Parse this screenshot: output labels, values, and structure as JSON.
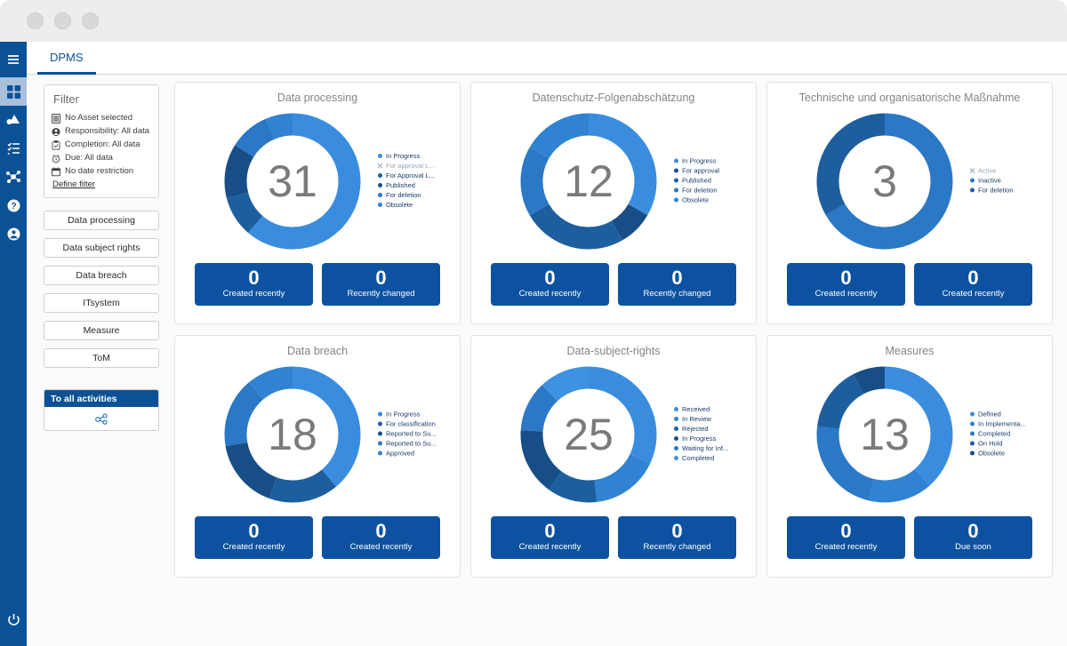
{
  "window": {
    "dots": [
      "traffic-light-1",
      "traffic-light-2",
      "traffic-light-3"
    ]
  },
  "rail": {
    "items": [
      {
        "icon": "hamburger-menu-icon",
        "name": "menu-toggle",
        "active": false
      },
      {
        "icon": "dashboard-grid-icon",
        "name": "dashboard",
        "active": true
      },
      {
        "icon": "assets-icon",
        "name": "assets",
        "active": false
      },
      {
        "icon": "task-list-icon",
        "name": "tasks",
        "active": false
      },
      {
        "icon": "network-graph-icon",
        "name": "network",
        "active": false
      },
      {
        "icon": "help-circle-icon",
        "name": "help",
        "active": false
      },
      {
        "icon": "user-account-icon",
        "name": "account",
        "active": false
      }
    ],
    "bottom": {
      "icon": "power-icon",
      "name": "logout"
    }
  },
  "tabbar": {
    "active_tab": "DPMS"
  },
  "filter": {
    "title": "Filter",
    "rows": [
      {
        "icon": "asset-icon",
        "text": "No Asset selected"
      },
      {
        "icon": "person-icon",
        "text": "Responsibility: All data"
      },
      {
        "icon": "clipboard-check-icon",
        "text": "Completion: All data"
      },
      {
        "icon": "alarm-clock-icon",
        "text": "Due: All data"
      },
      {
        "icon": "calendar-icon",
        "text": "No date restriction"
      }
    ],
    "define_filter": "Define filter"
  },
  "nav_buttons": [
    "Data processing",
    "Data subject rights",
    "Data breach",
    "ITsystem",
    "Measure",
    "ToM"
  ],
  "activities": {
    "header": "To all activities",
    "icon": "activities-share-icon"
  },
  "chart_data": [
    {
      "type": "pie",
      "title": "Data processing",
      "center_value": "31",
      "legend_position": "right",
      "categories": [
        "In Progress",
        "For approval L...",
        "For Approval L...",
        "Published",
        "For deletion",
        "Obsolete"
      ],
      "values": [
        19,
        0,
        3,
        4,
        3,
        2
      ],
      "hidden": [
        false,
        true,
        false,
        false,
        false,
        false
      ],
      "colors": [
        "#3a8dde",
        "#8aa4bd",
        "#1d5f9e",
        "#174e88",
        "#2a78c6",
        "#2f83d2"
      ],
      "stats": [
        {
          "value": "0",
          "label": "Created recently"
        },
        {
          "value": "0",
          "label": "Recently changed"
        }
      ]
    },
    {
      "type": "pie",
      "title": "Datenschutz-Folgenabschätzung",
      "center_value": "12",
      "legend_position": "right",
      "categories": [
        "In Progress",
        "For approval",
        "Published",
        "For deletion",
        "Obsolete"
      ],
      "values": [
        4,
        1,
        3,
        2,
        2
      ],
      "hidden": [
        false,
        false,
        false,
        false,
        false
      ],
      "colors": [
        "#3a8dde",
        "#174e88",
        "#1d5f9e",
        "#2a78c6",
        "#2f83d2"
      ],
      "stats": [
        {
          "value": "0",
          "label": "Created recently"
        },
        {
          "value": "0",
          "label": "Recently changed"
        }
      ]
    },
    {
      "type": "pie",
      "title": "Technische und organisatorische Maßnahme",
      "center_value": "3",
      "legend_position": "right",
      "categories": [
        "Active",
        "Inactive",
        "For deletion"
      ],
      "values": [
        0,
        2,
        1
      ],
      "hidden": [
        true,
        false,
        false
      ],
      "colors": [
        "#8aa4bd",
        "#2a78c6",
        "#1d5f9e"
      ],
      "stats": [
        {
          "value": "0",
          "label": "Created recently"
        },
        {
          "value": "0",
          "label": "Created recently"
        }
      ]
    },
    {
      "type": "pie",
      "title": "Data breach",
      "center_value": "18",
      "legend_position": "right",
      "categories": [
        "In Progress",
        "For classification",
        "Reported to Su...",
        "Reported to Su...",
        "Approved"
      ],
      "values": [
        7,
        3,
        3,
        3,
        2
      ],
      "hidden": [
        false,
        false,
        false,
        false,
        false
      ],
      "colors": [
        "#3a8dde",
        "#1d5f9e",
        "#174e88",
        "#2a78c6",
        "#2f83d2"
      ],
      "stats": [
        {
          "value": "0",
          "label": "Created recently"
        },
        {
          "value": "0",
          "label": "Created recently"
        }
      ]
    },
    {
      "type": "pie",
      "title": "Data-subject-rights",
      "center_value": "25",
      "legend_position": "right",
      "categories": [
        "Received",
        "In Review",
        "Rejected",
        "In Progress",
        "Waiting for Inf...",
        "Completed"
      ],
      "values": [
        8,
        4,
        3,
        4,
        3,
        3
      ],
      "hidden": [
        false,
        false,
        false,
        false,
        false,
        false
      ],
      "colors": [
        "#3a8dde",
        "#2f83d2",
        "#1d5f9e",
        "#174e88",
        "#2a78c6",
        "#3d92e2"
      ],
      "stats": [
        {
          "value": "0",
          "label": "Created recently"
        },
        {
          "value": "0",
          "label": "Recently changed"
        }
      ]
    },
    {
      "type": "pie",
      "title": "Measures",
      "center_value": "13",
      "legend_position": "right",
      "categories": [
        "Defined",
        "In Implementa...",
        "Completed",
        "On Hold",
        "Obsolete"
      ],
      "values": [
        5,
        2,
        3,
        2,
        1
      ],
      "hidden": [
        false,
        false,
        false,
        false,
        false
      ],
      "colors": [
        "#3a8dde",
        "#2f83d2",
        "#2a78c6",
        "#1d5f9e",
        "#174e88"
      ],
      "stats": [
        {
          "value": "0",
          "label": "Created recently"
        },
        {
          "value": "0",
          "label": "Due soon"
        }
      ]
    }
  ],
  "theme": {
    "brand_blue": "#0b5196",
    "stat_blue": "#0d52a0",
    "accent_light": "#3a8dde",
    "title_gray": "#848484"
  }
}
